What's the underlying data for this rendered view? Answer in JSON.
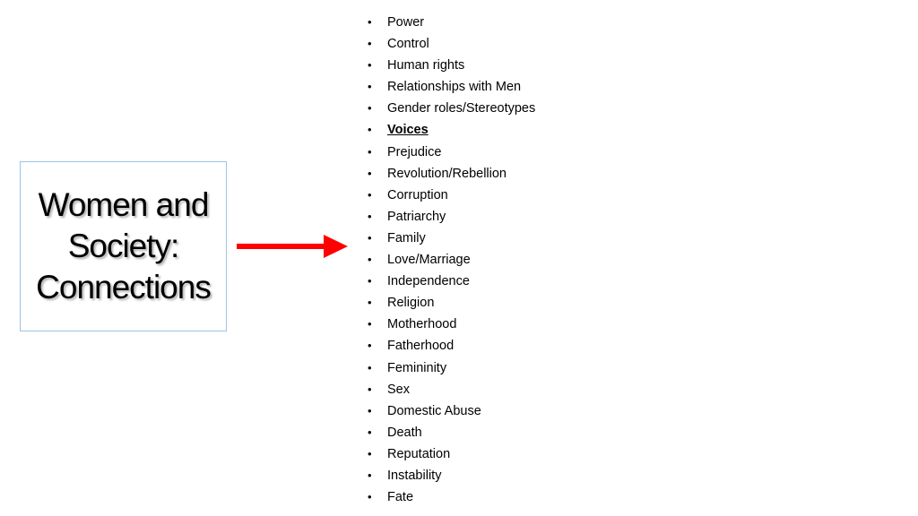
{
  "title_box": {
    "text": "Women and\nSociety:\nConnections"
  },
  "arrow": {
    "color": "#ff0000",
    "icon": "right-arrow-icon"
  },
  "topics": {
    "bullet": "•",
    "items": [
      {
        "label": "Power",
        "emphasized": false
      },
      {
        "label": "Control",
        "emphasized": false
      },
      {
        "label": "Human rights",
        "emphasized": false
      },
      {
        "label": "Relationships with Men",
        "emphasized": false
      },
      {
        "label": "Gender roles/Stereotypes",
        "emphasized": false
      },
      {
        "label": "Voices",
        "emphasized": true
      },
      {
        "label": "Prejudice",
        "emphasized": false
      },
      {
        "label": "Revolution/Rebellion",
        "emphasized": false
      },
      {
        "label": "Corruption",
        "emphasized": false
      },
      {
        "label": "Patriarchy",
        "emphasized": false
      },
      {
        "label": "Family",
        "emphasized": false
      },
      {
        "label": "Love/Marriage",
        "emphasized": false
      },
      {
        "label": "Independence",
        "emphasized": false
      },
      {
        "label": "Religion",
        "emphasized": false
      },
      {
        "label": "Motherhood",
        "emphasized": false
      },
      {
        "label": "Fatherhood",
        "emphasized": false
      },
      {
        "label": "Femininity",
        "emphasized": false
      },
      {
        "label": "Sex",
        "emphasized": false
      },
      {
        "label": "Domestic Abuse",
        "emphasized": false
      },
      {
        "label": "Death",
        "emphasized": false
      },
      {
        "label": "Reputation",
        "emphasized": false
      },
      {
        "label": "Instability",
        "emphasized": false
      },
      {
        "label": "Fate",
        "emphasized": false
      }
    ]
  }
}
